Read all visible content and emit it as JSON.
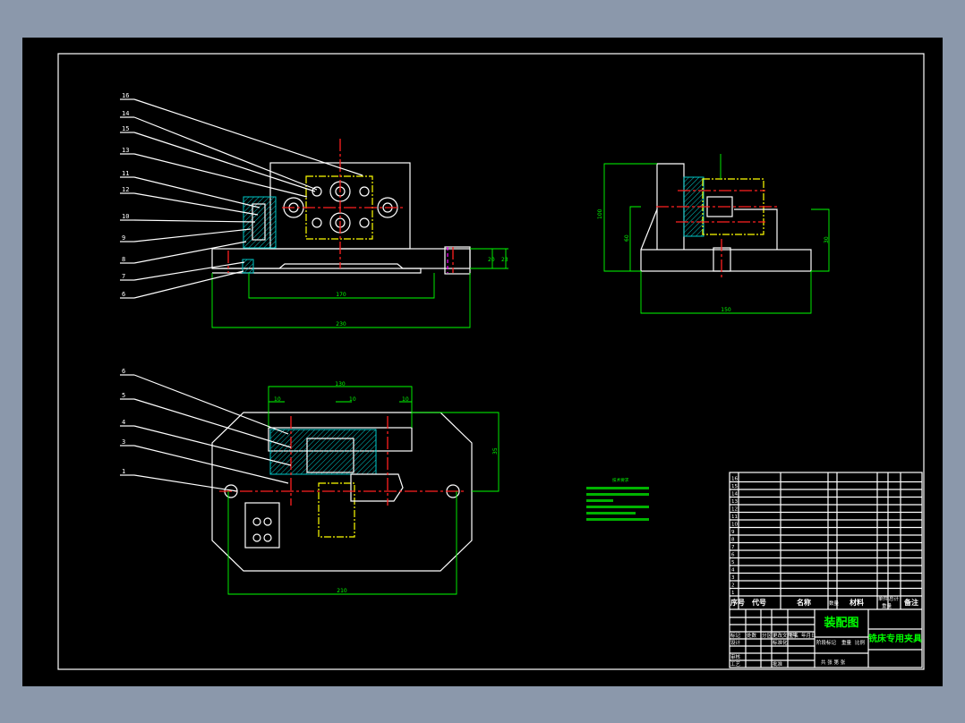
{
  "colors": {
    "background": "#8b98ab",
    "drawing_area": "#000000",
    "outline": "#ffffff",
    "dimension": "#00ff00",
    "centerline": "#ff2020",
    "hidden": "#ffff00",
    "section": "#00c8c8",
    "phantom": "#ff00ff"
  },
  "front_view": {
    "leader_labels": [
      "16",
      "14",
      "15",
      "13",
      "11",
      "12",
      "10",
      "9",
      "8",
      "7",
      "6"
    ],
    "dims": {
      "inner_width": "170",
      "overall_width": "230",
      "h1": "20",
      "h2": "23"
    }
  },
  "side_view": {
    "dims": {
      "width": "150",
      "height_total": "100",
      "height_mid": "60",
      "height_right": "30"
    }
  },
  "top_view": {
    "leader_labels": [
      "6",
      "5",
      "4",
      "3",
      "1"
    ],
    "dims": {
      "width": "130",
      "d1": "10",
      "d2": "10",
      "d3": "10",
      "length": "210",
      "height": "35"
    }
  },
  "technical_requirements": {
    "title": "技术要求"
  },
  "title_block": {
    "part_numbers": [
      "16",
      "15",
      "14",
      "13",
      "12",
      "11",
      "10",
      "9",
      "8",
      "7",
      "6",
      "5",
      "4",
      "3",
      "2",
      "1"
    ],
    "headers": {
      "seq": "序号",
      "code": "代号",
      "name": "名称",
      "qty": "数量",
      "material": "材料",
      "single": "单件",
      "total": "总计",
      "weight": "重量",
      "remark": "备注"
    },
    "drawing_name": "装配图",
    "product_name": "铣床专用夹具",
    "rev_labels": {
      "mark": "标记",
      "count": "处数",
      "zone": "分区",
      "doc": "更改文件号",
      "sign": "签名",
      "date": "年月日"
    },
    "roles": {
      "design": "设计",
      "standard": "标准化",
      "review": "审核",
      "process": "工艺",
      "approve": "批准"
    },
    "stage_labels": {
      "stage": "阶段标记",
      "weight": "重量",
      "scale": "比例"
    },
    "sheet": {
      "text": "共 张 第 张"
    }
  }
}
